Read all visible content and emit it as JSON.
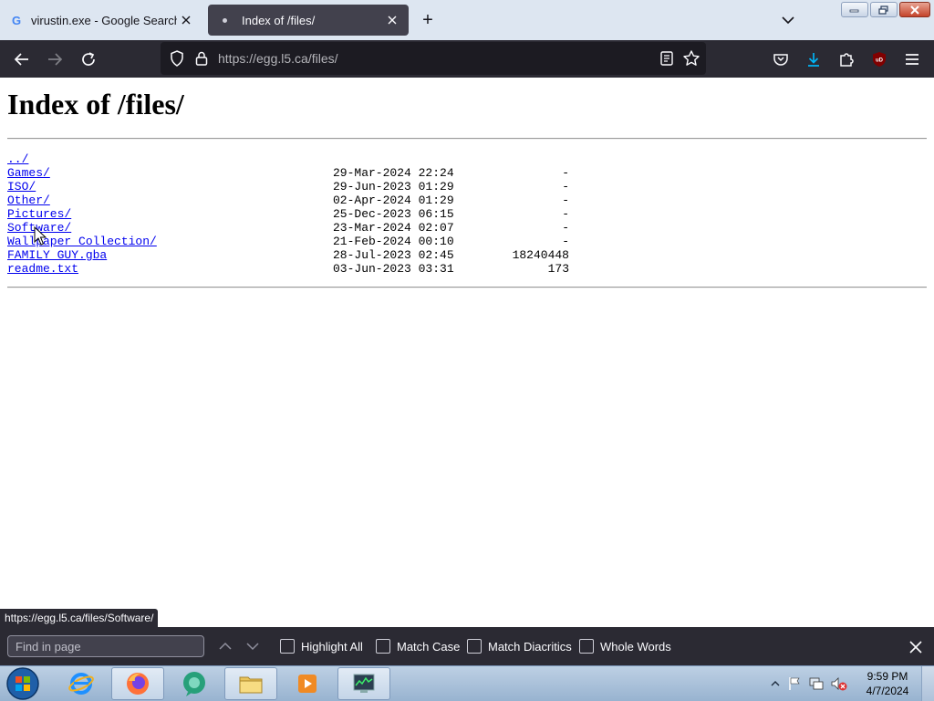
{
  "browser": {
    "tabs": [
      {
        "title": "virustin.exe - Google Search",
        "favicon": "google-g-icon",
        "active": false
      },
      {
        "title": "Index of /files/",
        "favicon": "dot-icon",
        "active": true
      }
    ],
    "new_tab_label": "+",
    "url": "https://egg.l5.ca/files/",
    "status_url": "https://egg.l5.ca/files/Software/"
  },
  "page": {
    "heading": "Index of /files/",
    "entries": [
      {
        "name": "../",
        "date": "",
        "size": ""
      },
      {
        "name": "Games/",
        "date": "29-Mar-2024 22:24",
        "size": "-"
      },
      {
        "name": "ISO/",
        "date": "29-Jun-2023 01:29",
        "size": "-"
      },
      {
        "name": "Other/",
        "date": "02-Apr-2024 01:29",
        "size": "-"
      },
      {
        "name": "Pictures/",
        "date": "25-Dec-2023 06:15",
        "size": "-"
      },
      {
        "name": "Software/",
        "date": "23-Mar-2024 02:07",
        "size": "-"
      },
      {
        "name": "Wallpaper Collection/",
        "date": "21-Feb-2024 00:10",
        "size": "-"
      },
      {
        "name": "FAMILY GUY.gba",
        "date": "28-Jul-2023 02:45",
        "size": "18240448"
      },
      {
        "name": "readme.txt",
        "date": "03-Jun-2023 03:31",
        "size": "173"
      }
    ]
  },
  "findbar": {
    "placeholder": "Find in page",
    "options": [
      "Highlight All",
      "Match Case",
      "Match Diacritics",
      "Whole Words"
    ]
  },
  "taskbar": {
    "time": "9:59 PM",
    "date": "4/7/2024"
  },
  "colors": {
    "link": "#0000ee",
    "toolbar": "#2b2a33",
    "tabstrip": "#dde6f1",
    "download_accent": "#00b3f4",
    "ublock_red": "#800000"
  }
}
